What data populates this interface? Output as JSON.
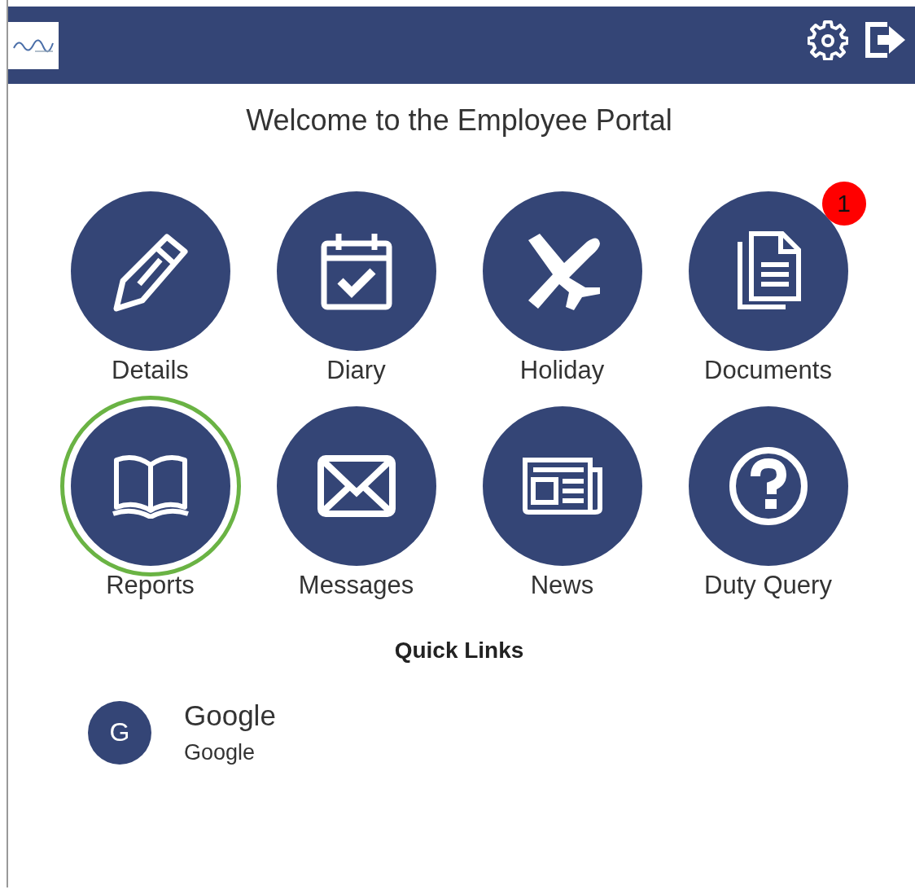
{
  "header": {
    "buttons": [
      {
        "kind": "settings"
      },
      {
        "kind": "logout"
      }
    ]
  },
  "welcome": "Welcome to the Employee Portal",
  "tiles": [
    {
      "label": "Details",
      "kind": "pencil",
      "selected": false
    },
    {
      "label": "Diary",
      "kind": "calendar",
      "selected": false
    },
    {
      "label": "Holiday",
      "kind": "plane",
      "selected": false
    },
    {
      "label": "Documents",
      "kind": "documents",
      "selected": false,
      "badge": "1"
    },
    {
      "label": "Reports",
      "kind": "book",
      "selected": true
    },
    {
      "label": "Messages",
      "kind": "envelope",
      "selected": false
    },
    {
      "label": "News",
      "kind": "newspaper",
      "selected": false
    },
    {
      "label": "Duty Query",
      "kind": "question",
      "selected": false
    }
  ],
  "quick_links": {
    "title": "Quick Links",
    "items": [
      {
        "avatar": "G",
        "title": "Google",
        "subtitle": "Google"
      }
    ]
  }
}
